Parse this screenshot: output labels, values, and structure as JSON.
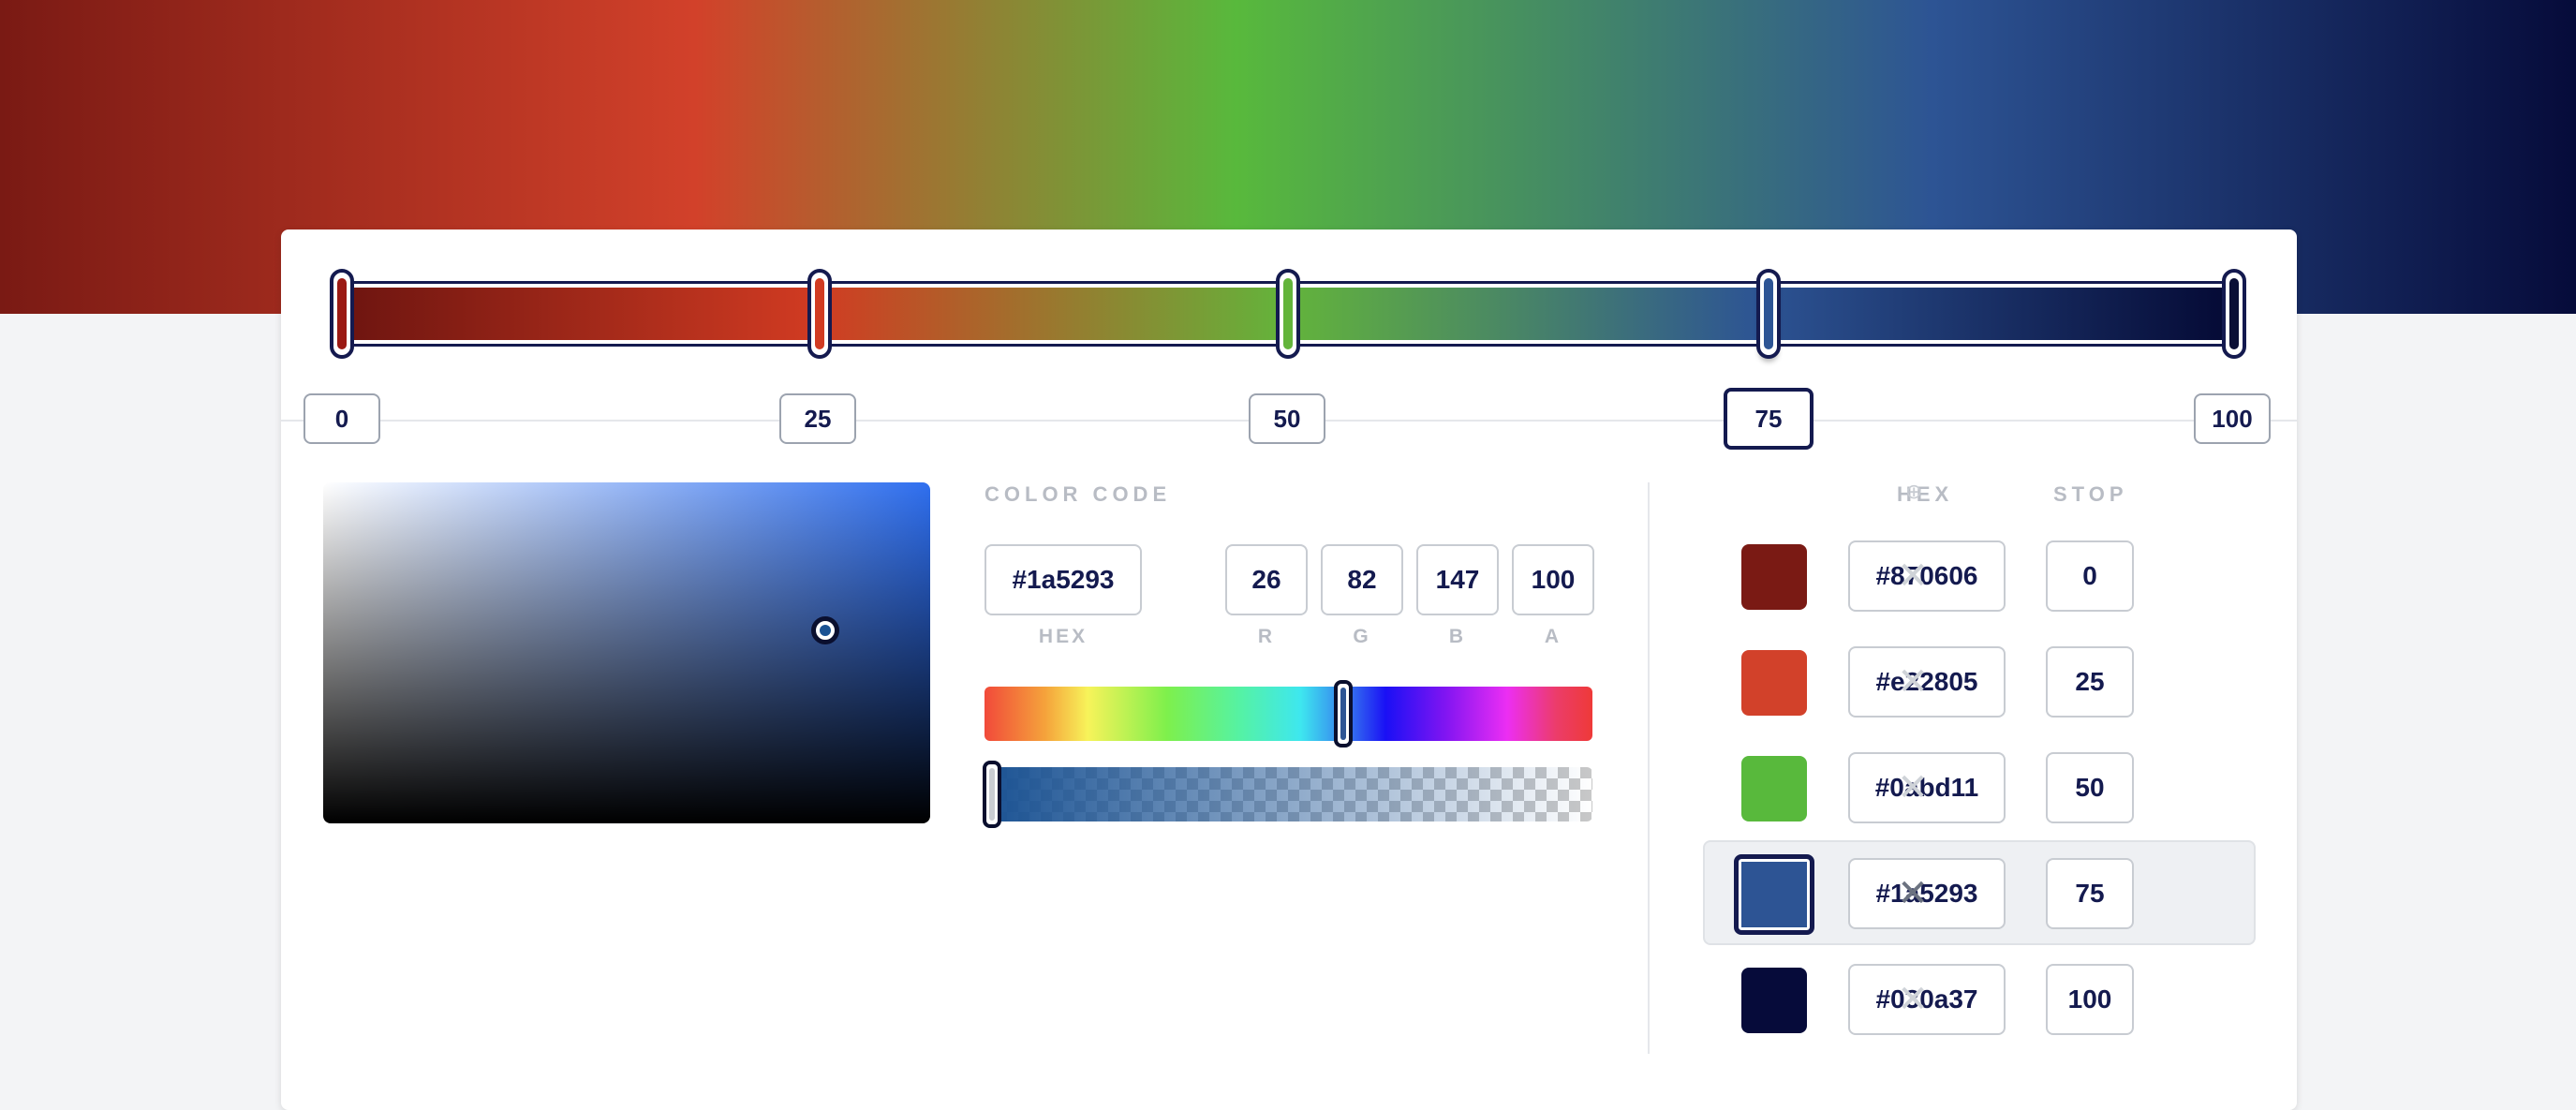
{
  "gradient": {
    "stops": [
      {
        "position": 0,
        "hex": "#870606",
        "swatch": "#7a1a14"
      },
      {
        "position": 25,
        "hex": "#e22805",
        "swatch": "#d2412a"
      },
      {
        "position": 50,
        "hex": "#0abd11",
        "swatch": "#58b93c"
      },
      {
        "position": 75,
        "hex": "#1a5293",
        "swatch": "#2d5494"
      },
      {
        "position": 100,
        "hex": "#030a37",
        "swatch": "#060b3a"
      }
    ],
    "active_index": 3
  },
  "stop_labels": [
    "0",
    "25",
    "50",
    "75",
    "100"
  ],
  "picker": {
    "section_label": "COLOR CODE",
    "hex_value": "#1a5293",
    "hex_label": "HEX",
    "r_value": "26",
    "r_label": "R",
    "g_value": "82",
    "g_label": "G",
    "b_value": "147",
    "b_label": "B",
    "a_value": "100",
    "a_label": "A",
    "hue_fraction": 0.59,
    "alpha_fraction": 1.0
  },
  "stop_list": {
    "hex_header": "HEX",
    "stop_header": "STOP",
    "add_icon": "⊕",
    "remove_icon": "✕",
    "rows": [
      {
        "hex": "#870606",
        "stop": "0"
      },
      {
        "hex": "#e22805",
        "stop": "25"
      },
      {
        "hex": "#0abd11",
        "stop": "50"
      },
      {
        "hex": "#1a5293",
        "stop": "75"
      },
      {
        "hex": "#030a37",
        "stop": "100"
      }
    ]
  }
}
